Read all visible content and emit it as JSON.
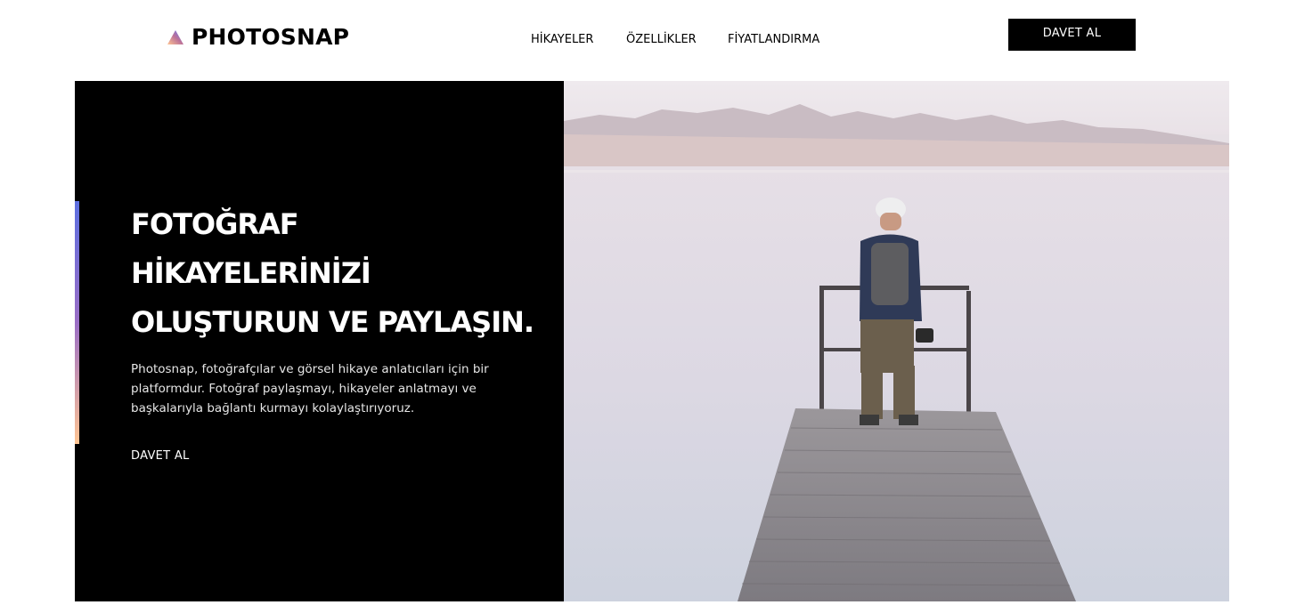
{
  "header": {
    "logo_text": "PHOTOSNAP",
    "logo_icon": "triangle-gradient-icon",
    "nav": [
      {
        "label": "HİKAYELER"
      },
      {
        "label": "ÖZELLİKLER"
      },
      {
        "label": "FİYATLANDIRMA"
      }
    ],
    "cta_label": "DAVET AL"
  },
  "hero": {
    "title_lines": [
      "FOTOĞRAF",
      "HİKAYELERİNİZİ",
      "OLUŞTURUN VE PAYLAŞIN."
    ],
    "description_lines": [
      "Photosnap, fotoğrafçılar ve görsel hikaye anlatıcıları için bir",
      "platformdur. Fotoğraf paylaşmayı, hikayeler anlatmayı ve",
      "başkalarıyla bağlantı kurmayı kolaylaştırıyoruz."
    ],
    "cta_label": "DAVET AL",
    "image_subject": "man-with-camera-on-pier-photo"
  },
  "colors": {
    "background": "#ffffff",
    "hero_panel": "#000000",
    "accent_gradient_start": "#5c6fe0",
    "accent_gradient_mid": "#9a6ec5",
    "accent_gradient_end": "#ffc593"
  }
}
